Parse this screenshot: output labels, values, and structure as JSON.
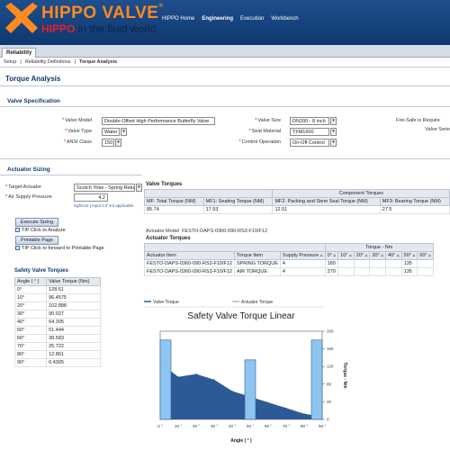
{
  "header": {
    "brand": "HIPPO VALVE",
    "reg": "®",
    "tagline_red": "HIPPO",
    "tagline_rest": " in the fluid world.",
    "nav": [
      "HIPPO Home",
      "Engineering",
      "Execution",
      "Workbench"
    ]
  },
  "tabstrip": {
    "tab": "Reliability"
  },
  "breadcrumb": [
    "Setup",
    "|",
    "Reliability Definitions",
    "|",
    "Torque Analysis"
  ],
  "page_title": "Torque Analysis",
  "valve_spec": {
    "title": "Valve Specification",
    "valve_model_label": "Valve Model",
    "valve_model": "Double-Offset High Performance Butterfly Valve",
    "valve_type_label": "Valve Type",
    "valve_type": "Water",
    "ansi_class_label": "ANSI Class",
    "ansi_class": "150",
    "valve_size_label": "Valve Size",
    "valve_size": "DN200 - 8 inch",
    "seat_material_label": "Seat Material",
    "seat_material": "TFM1600",
    "control_operation_label": "Control Operation",
    "control_operation": "On-Off Control",
    "fire_safe_label": "Fire-Safe is Require",
    "valve_series_label": "Valve Serie"
  },
  "actuator": {
    "title": "Actuator Sizing",
    "target_label": "Target Actuator",
    "target": "Scotch Yoke - Spring Return",
    "air_label": "Air Supply Pressure",
    "air_value": "4.2",
    "air_note": "Kgf/cm2 | Input 0 if not applicable",
    "execute_label": "Execute Sizing",
    "tip1": "TIP Click to Analyze",
    "print_label": "Printable Page",
    "tip2": "TIP Click to forward to Printable Page"
  },
  "safety_table": {
    "title": "Safety Valve Torques",
    "headers": [
      "Angle ( ° )",
      "Valve Torque (Nm)"
    ],
    "rows": [
      [
        "0°",
        "128.61"
      ],
      [
        "10°",
        "96.4575"
      ],
      [
        "20°",
        "102.888"
      ],
      [
        "30°",
        "90.027"
      ],
      [
        "40°",
        "64.305"
      ],
      [
        "50°",
        "51.444"
      ],
      [
        "60°",
        "38.583"
      ],
      [
        "70°",
        "25.722"
      ],
      [
        "80°",
        "12.861"
      ],
      [
        "90°",
        "6.4305"
      ]
    ]
  },
  "valve_torques": {
    "title": "Valve Torques",
    "group_header": "Component Torques",
    "headers": [
      "MF: Total Torque (NM)",
      "MF1: Seating Torque (NM)",
      "MF2: Packing and Stem Seal Torque (NM)",
      "MF3: Bearing Torque (NM)"
    ],
    "row": [
      "85.74",
      "17.93",
      "12.51",
      "27.5"
    ]
  },
  "actuator_model": {
    "label": "Actuator Model",
    "value": "FESTO-DAPS-0360-090-RS3-F10/F12"
  },
  "actuator_torques": {
    "title": "Actuator Torques",
    "group_header": "Torque - Nm",
    "headers": [
      "Actuator Item",
      "Torque Item",
      "Supply Pressure",
      "0°",
      "10°",
      "20°",
      "30°",
      "40°",
      "50°",
      "60°"
    ],
    "rows": [
      [
        "FESTO-DAPS-0360-090-RS3-F10/F12",
        "SPRING TORQUE",
        "4",
        "180",
        "",
        "",
        "",
        "",
        "135",
        ""
      ],
      [
        "FESTO-DAPS-0360-090-RS3-F10/F12",
        "AIR TORQUE",
        "4",
        "270",
        "",
        "",
        "",
        "",
        "135",
        ""
      ]
    ]
  },
  "chart_data": {
    "type": "area",
    "title": "Safety Valve Torque Linear",
    "xlabel": "Angle ( ° )",
    "ylabel": "Torque - Nm",
    "legend": [
      "Valve Torque",
      "Actuator Torque"
    ],
    "legend_position": "top",
    "x": [
      "0 °",
      "10 °",
      "20 °",
      "30 °",
      "40 °",
      "50 °",
      "60 °",
      "70 °",
      "80 °",
      "90 °"
    ],
    "ylim": [
      0,
      200
    ],
    "yticks": [
      "0",
      "40",
      "80",
      "120",
      "160",
      "200"
    ],
    "series": [
      {
        "name": "Valve Torque",
        "values": [
          128.61,
          96.4575,
          102.888,
          90.027,
          64.305,
          51.444,
          38.583,
          25.722,
          12.861,
          6.4305
        ]
      },
      {
        "name": "Actuator Torque",
        "bars": [
          {
            "x": "0 °",
            "value": 180
          },
          {
            "x": "50 °",
            "value": 135
          },
          {
            "x": "90 °",
            "value": 180
          }
        ]
      }
    ],
    "colors": {
      "area": "#2d5a96",
      "bar": "#8ec4f0",
      "bar_edge": "#2d5a96"
    }
  }
}
